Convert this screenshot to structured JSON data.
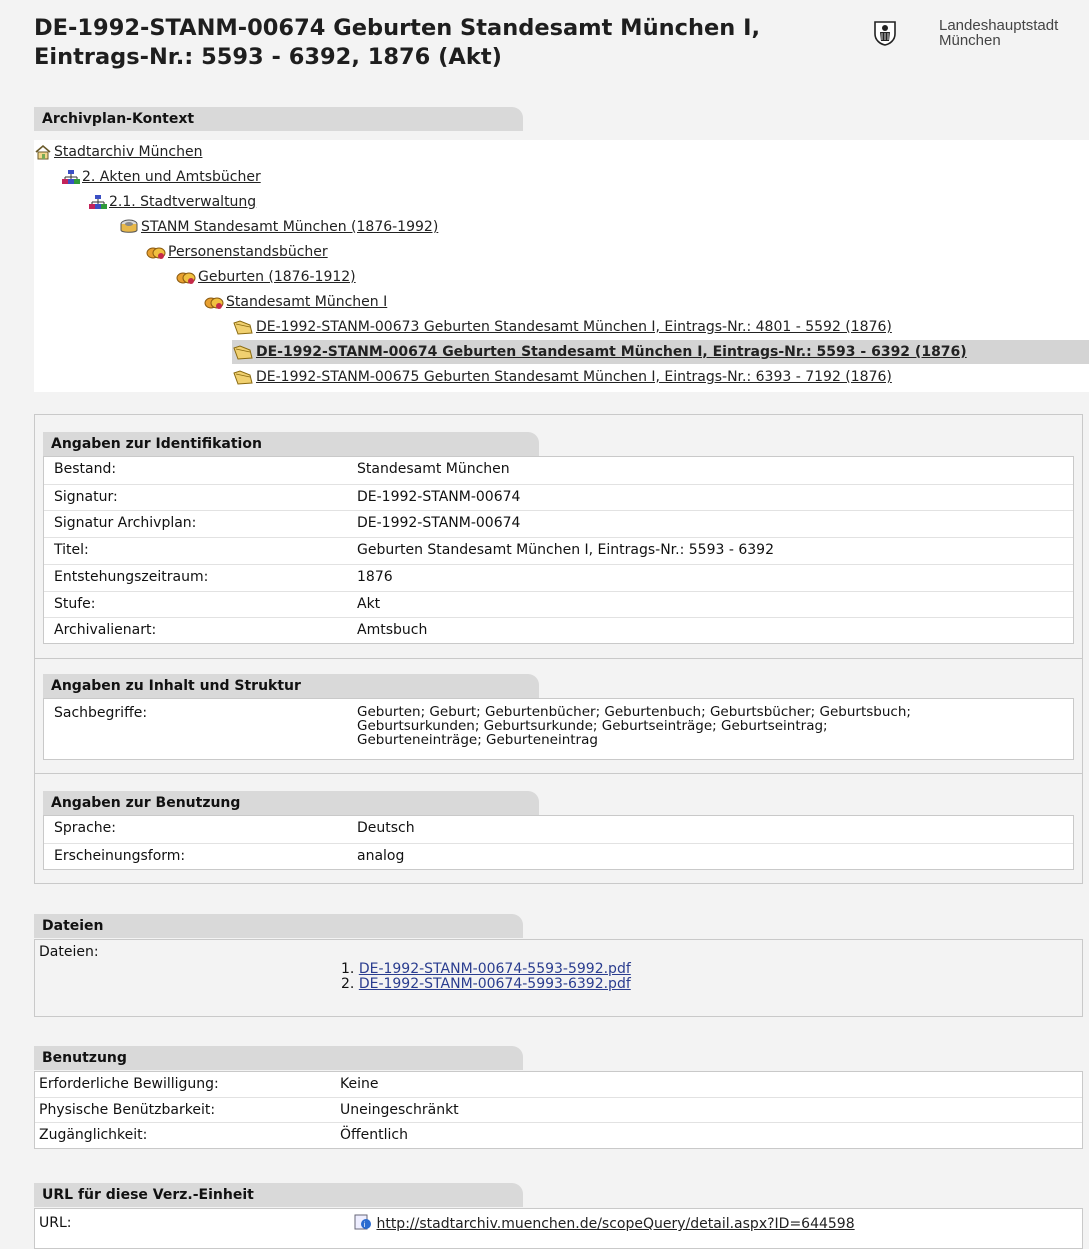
{
  "title": "DE-1992-STANM-00674 Geburten Standesamt München I, Eintrags-Nr.: 5593 - 6392, 1876 (Akt)",
  "logo": {
    "line1": "Landeshauptstadt",
    "line2": "München",
    "icon": "muenchner-kindl-icon"
  },
  "context": {
    "heading": "Archivplan-Kontext",
    "nodes": [
      {
        "label": "Stadtarchiv München",
        "icon": "home-icon"
      },
      {
        "label": "2. Akten und Amtsbücher",
        "icon": "hierarchy-icon"
      },
      {
        "label": "2.1. Stadtverwaltung",
        "icon": "hierarchy-icon"
      },
      {
        "label": "STANM Standesamt München (1876-1992)",
        "icon": "fonds-icon"
      },
      {
        "label": "Personenstandsbücher",
        "icon": "series-icon"
      },
      {
        "label": "Geburten (1876-1912)",
        "icon": "series-icon"
      },
      {
        "label": "Standesamt München I",
        "icon": "series-icon"
      },
      {
        "label": "DE-1992-STANM-00673 Geburten Standesamt München I, Eintrags-Nr.: 4801 - 5592 (1876)",
        "icon": "file-folder-icon"
      },
      {
        "label": "DE-1992-STANM-00674 Geburten Standesamt München I, Eintrags-Nr.: 5593 - 6392 (1876)",
        "icon": "file-folder-icon",
        "selected": true
      },
      {
        "label": "DE-1992-STANM-00675 Geburten Standesamt München I, Eintrags-Nr.: 6393 - 7192 (1876)",
        "icon": "file-folder-icon"
      }
    ]
  },
  "identification": {
    "heading": "Angaben zur Identifikation",
    "rows": [
      {
        "label": "Bestand:",
        "value": "Standesamt München"
      },
      {
        "label": "Signatur:",
        "value": "DE-1992-STANM-00674"
      },
      {
        "label": "Signatur Archivplan:",
        "value": "DE-1992-STANM-00674"
      },
      {
        "label": "Titel:",
        "value": "Geburten Standesamt München I, Eintrags-Nr.: 5593 - 6392"
      },
      {
        "label": "Entstehungszeitraum:",
        "value": "1876"
      },
      {
        "label": "Stufe:",
        "value": "Akt"
      },
      {
        "label": "Archivalienart:",
        "value": "Amtsbuch"
      }
    ]
  },
  "content": {
    "heading": "Angaben zu Inhalt und Struktur",
    "label": "Sachbegriffe:",
    "lines": [
      "Geburten; Geburt; Geburtenbücher; Geburtenbuch; Geburtsbücher; Geburtsbuch;",
      "Geburtsurkunden; Geburtsurkunde; Geburtseinträge; Geburtseintrag;",
      "Geburteneinträge; Geburteneintrag"
    ]
  },
  "usage_info": {
    "heading": "Angaben zur Benutzung",
    "rows": [
      {
        "label": "Sprache:",
        "value": "Deutsch"
      },
      {
        "label": "Erscheinungsform:",
        "value": "analog"
      }
    ]
  },
  "files": {
    "heading": "Dateien",
    "label": "Dateien:",
    "items": [
      {
        "num": "1.",
        "name": "DE-1992-STANM-00674-5593-5992.pdf"
      },
      {
        "num": "2.",
        "name": "DE-1992-STANM-00674-5993-6392.pdf"
      }
    ]
  },
  "benutzung": {
    "heading": "Benutzung",
    "rows": [
      {
        "label": "Erforderliche Bewilligung:",
        "value": "Keine"
      },
      {
        "label": "Physische Benützbarkeit:",
        "value": "Uneingeschränkt"
      },
      {
        "label": "Zugänglichkeit:",
        "value": "Öffentlich"
      }
    ]
  },
  "url_section": {
    "heading": "URL für diese Verz.-Einheit",
    "label": "URL:",
    "url": "http://stadtarchiv.muenchen.de/scopeQuery/detail.aspx?ID=644598",
    "icon": "link-icon"
  }
}
